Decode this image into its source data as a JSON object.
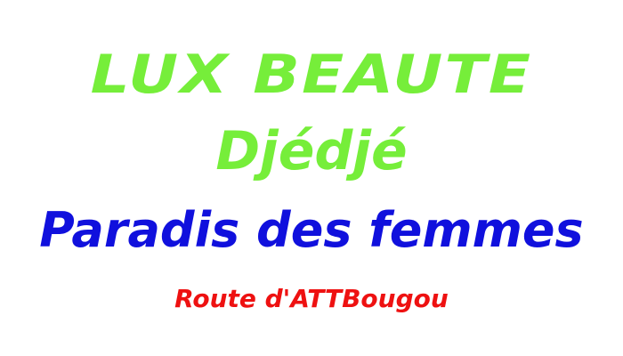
{
  "sign": {
    "brand": "LUX BEAUTE",
    "subtitle": "Djédjé",
    "tagline": "Paradis des femmes",
    "address": "Route d'ATTBougou"
  },
  "colors": {
    "brand": "#76ee3a",
    "tagline": "#1010dd",
    "address": "#ee1111",
    "background": "#ffffff"
  }
}
